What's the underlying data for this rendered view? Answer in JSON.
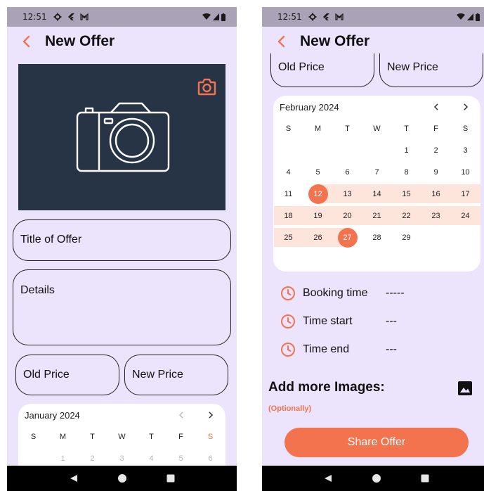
{
  "left": {
    "status": {
      "time": "12:51"
    },
    "appbar": {
      "title": "New Offer"
    },
    "fields": {
      "title_placeholder": "Title of Offer",
      "details_placeholder": "Details",
      "old_price": "Old Price",
      "new_price": "New Price"
    },
    "calendar": {
      "month": "January 2024",
      "weekdays": [
        "S",
        "M",
        "T",
        "W",
        "T",
        "F",
        "S"
      ],
      "first_row": [
        "1",
        "2",
        "3",
        "4",
        "5",
        "6"
      ]
    }
  },
  "right": {
    "status": {
      "time": "12:51"
    },
    "appbar": {
      "title": "New Offer"
    },
    "fields": {
      "old_price": "Old Price",
      "new_price": "New Price"
    },
    "calendar": {
      "month": "February 2024",
      "weekdays": [
        "S",
        "M",
        "T",
        "W",
        "T",
        "F",
        "S"
      ],
      "weeks": [
        [
          "",
          "",
          "",
          "",
          "1",
          "2",
          "3"
        ],
        [
          "4",
          "5",
          "6",
          "7",
          "8",
          "9",
          "10"
        ],
        [
          "11",
          "12",
          "13",
          "14",
          "15",
          "16",
          "17"
        ],
        [
          "18",
          "19",
          "20",
          "21",
          "22",
          "23",
          "24"
        ],
        [
          "25",
          "26",
          "27",
          "28",
          "29",
          "",
          ""
        ]
      ],
      "range_start": "12",
      "range_end": "27"
    },
    "times": [
      {
        "label": "Booking time",
        "value": "-----"
      },
      {
        "label": "Time start",
        "value": "---"
      },
      {
        "label": "Time end",
        "value": "---"
      }
    ],
    "more_images": {
      "title": "Add more Images:",
      "note": "(Optionally)"
    },
    "share_label": "Share Offer"
  },
  "colors": {
    "accent": "#f4734f",
    "background": "#ece4fc",
    "image_bg": "#263445",
    "range_band": "#fde5dc"
  },
  "icons": [
    "settings-icon",
    "flutter-icon",
    "gmail-icon",
    "wifi-icon",
    "signal-icon",
    "battery-icon",
    "back-arrow-icon",
    "camera-icon",
    "clock-icon",
    "image-icon",
    "nav-back-icon",
    "nav-home-icon",
    "nav-recents-icon",
    "chevron-left-icon",
    "chevron-right-icon"
  ]
}
